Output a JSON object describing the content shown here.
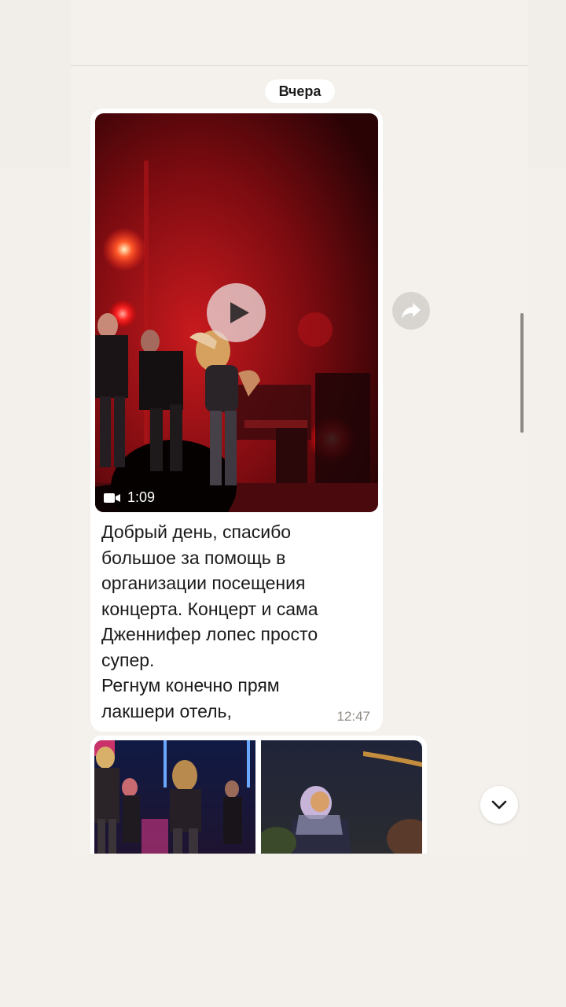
{
  "date_separator": "Вчера",
  "message": {
    "video": {
      "duration": "1:09",
      "play_icon": "play-icon",
      "camera_icon": "video-camera-icon"
    },
    "text": "Добрый день, спасибо\nбольшое за помощь в\nорганизации посещения\nконцерта. Концерт и сама\nДженнифер лопес просто\nсупер.\nРегнум конечно прям\nлакшери отель,",
    "time": "12:47"
  },
  "actions": {
    "forward_icon": "share-forward-icon",
    "scroll_down_icon": "chevron-down-icon"
  },
  "album": {
    "photo_count": 2
  },
  "colors": {
    "background": "#f3f0eb",
    "bubble": "#ffffff",
    "time_text": "#8e8a84",
    "stage_red": "#c81a1e"
  }
}
